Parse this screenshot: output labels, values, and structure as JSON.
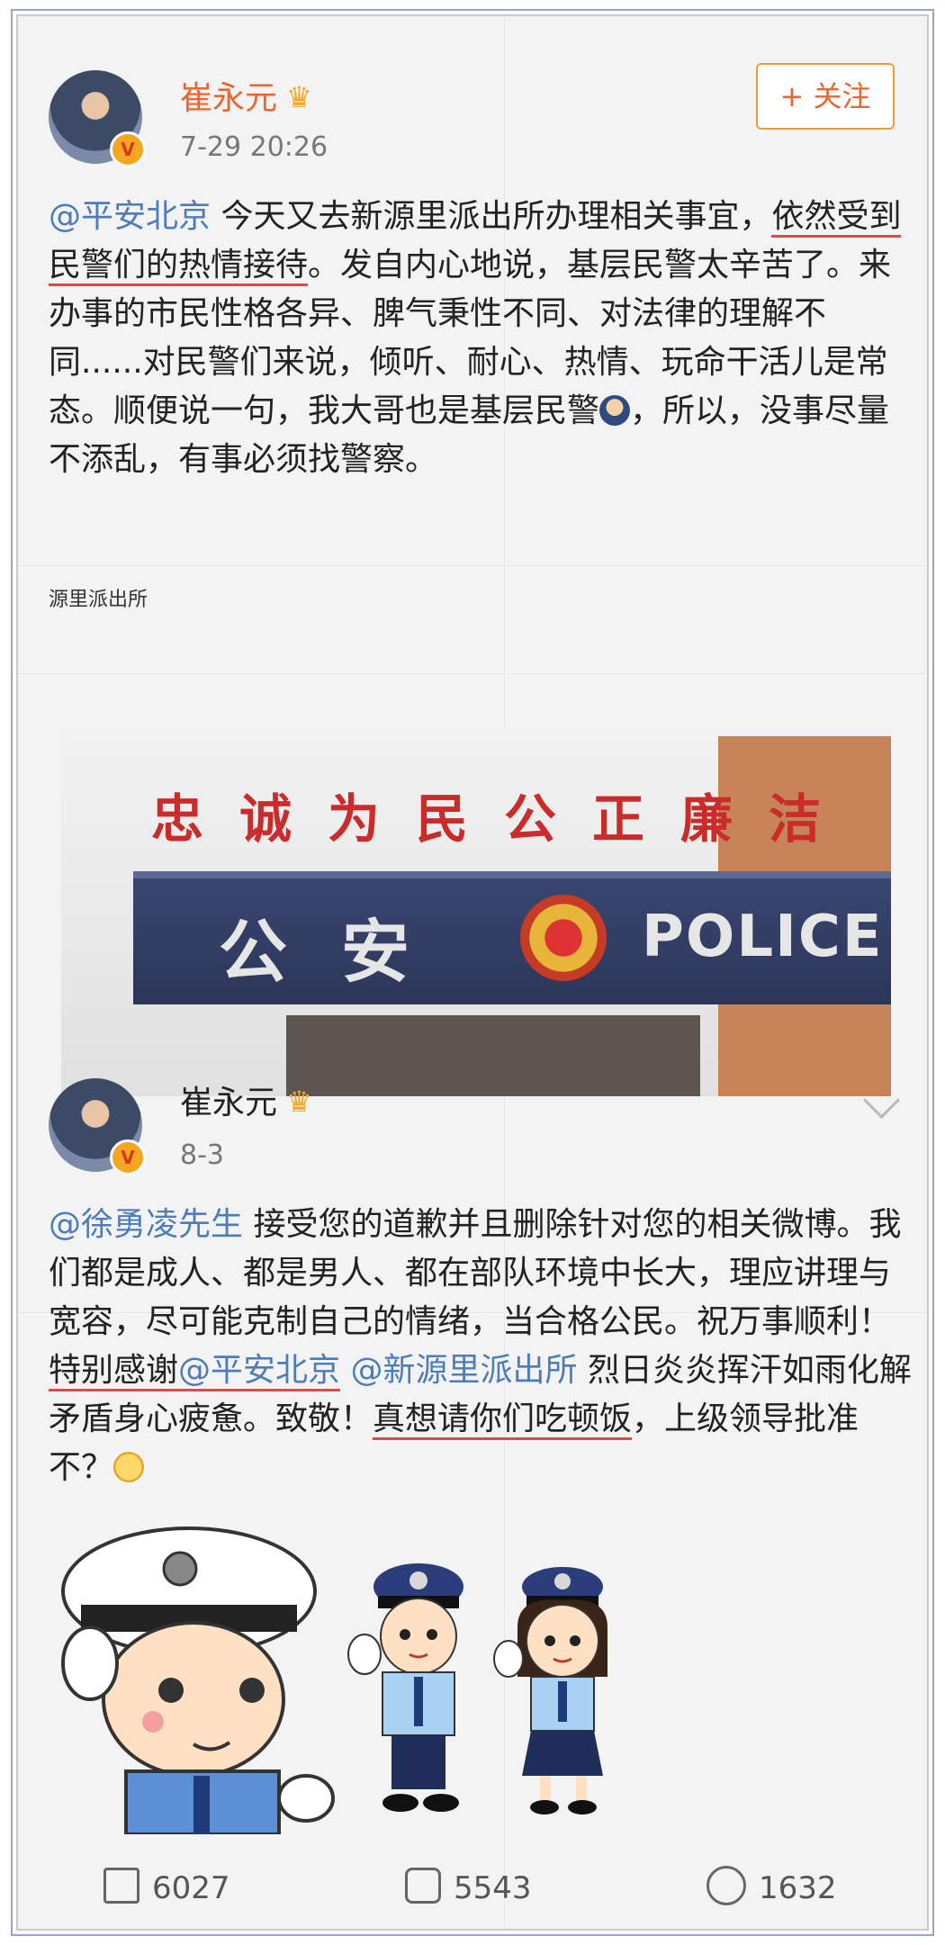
{
  "post1": {
    "author": "崔永元",
    "time": "7-29 20:26",
    "follow_label": "+ 关注",
    "mention": "@平安北京",
    "text_a": " 今天又去新源里派出所办理相关事宜，",
    "text_underlined": "依然受到民警们的热情接待",
    "text_b": "。发自内心地说，基层民警太辛苦了。来办事的市民性格各异、脾气秉性不同、对法律的理解不同......对民警们来说，倾听、耐心、热情、玩命干活儿是常态。顺便说一句，我大哥也是基层民警",
    "text_c": "，所以，没事尽量不添乱，有事必须找警察。",
    "photo_caption": "源里派出所",
    "photo_sign_top": "忠诚为民公正廉洁",
    "photo_sign_cn": "公安",
    "photo_sign_en": "POLICE"
  },
  "post2": {
    "author": "崔永元",
    "time": "8-3",
    "mention1": "@徐勇凌先生",
    "text_a": " 接受您的道歉并且删除针对您的相关微博。我们都是成人、都是男人、都在部队环境中长大，理应讲理与宽容，尽可能克制自己的情绪，当合格公民。祝万事顺利！",
    "text_underlined1": "特别感谢",
    "mention2": "@平安北京",
    "mention3": " @新源里派出所",
    "text_b": " 烈日炎炎挥汗如雨化解矛盾身心疲惫。致敬！",
    "text_underlined2": "真想请你们吃顿饭",
    "text_c": "，上级领导批准不？"
  },
  "actions": {
    "repost_count": "6027",
    "comment_count": "5543",
    "like_count": "1632"
  },
  "colors": {
    "brand_orange": "#e9662c",
    "mention_blue": "#4d7db8",
    "underline_red": "#e24646"
  }
}
